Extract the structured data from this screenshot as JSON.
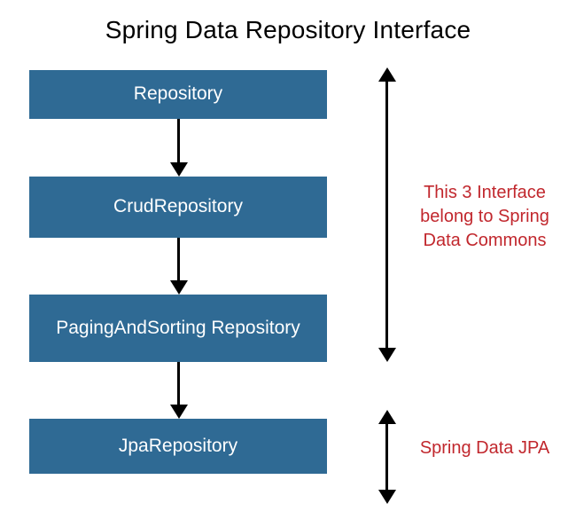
{
  "title": "Spring Data Repository Interface",
  "boxes": {
    "b1": "Repository",
    "b2": "CrudRepository",
    "b3": "PagingAndSorting Repository",
    "b4": "JpaRepository"
  },
  "annotations": {
    "commons": "This 3 Interface belong to Spring Data Commons",
    "jpa": "Spring Data JPA"
  },
  "colors": {
    "box_bg": "#2f6a94",
    "box_text": "#ffffff",
    "anno_text": "#c1272d"
  }
}
